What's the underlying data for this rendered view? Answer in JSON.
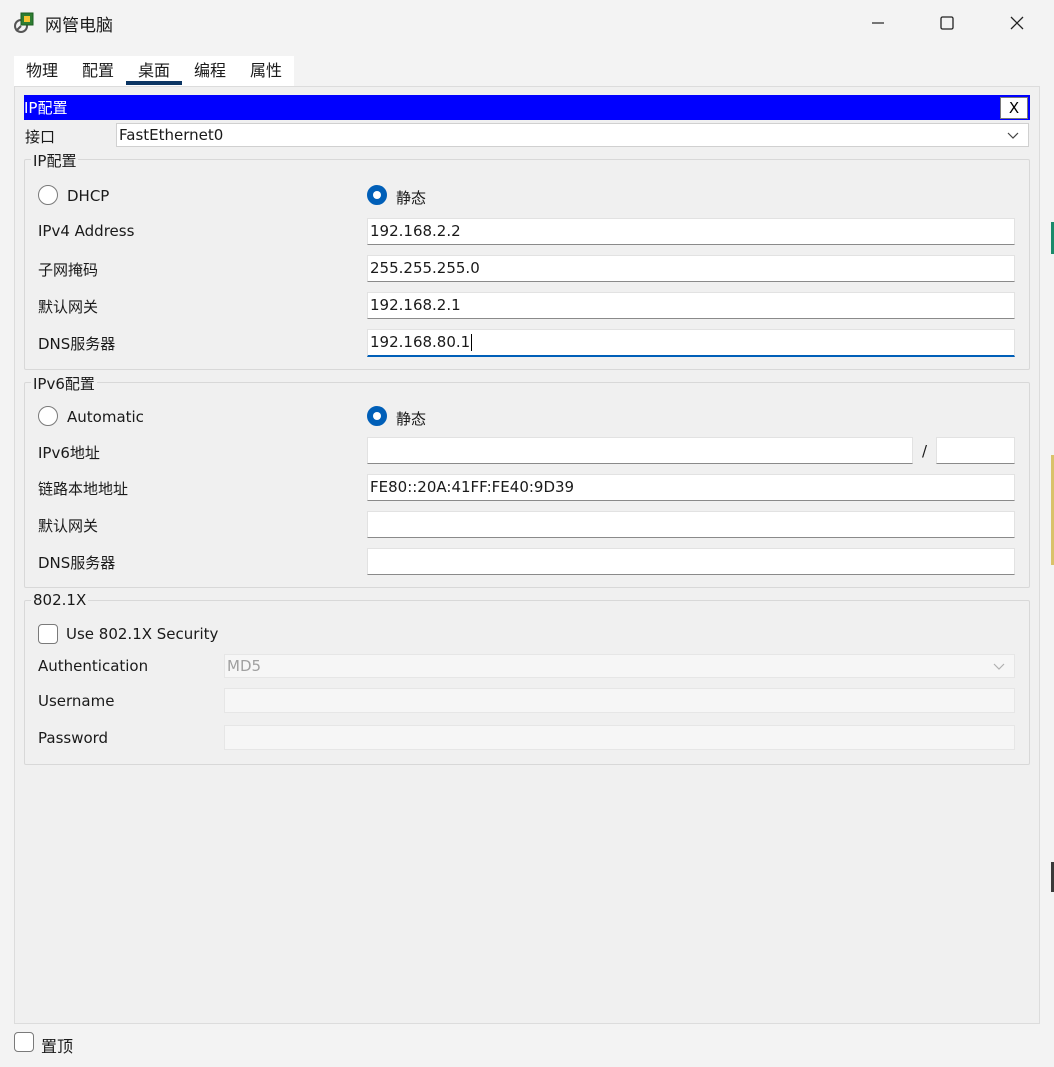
{
  "window": {
    "title": "网管电脑"
  },
  "tabs": [
    {
      "label": "物理"
    },
    {
      "label": "配置"
    },
    {
      "label": "桌面"
    },
    {
      "label": "编程"
    },
    {
      "label": "属性"
    }
  ],
  "ip_panel": {
    "header": "IP配置",
    "close_label": "X",
    "interface_label": "接口",
    "interface_value": "FastEthernet0"
  },
  "ipv4": {
    "group_title": "IP配置",
    "dhcp_label": "DHCP",
    "static_label": "静态",
    "mode_selected": "静态",
    "address_label": "IPv4 Address",
    "address_value": "192.168.2.2",
    "mask_label": "子网掩码",
    "mask_value": "255.255.255.0",
    "gateway_label": "默认网关",
    "gateway_value": "192.168.2.1",
    "dns_label": "DNS服务器",
    "dns_value": "192.168.80.1"
  },
  "ipv6": {
    "group_title": "IPv6配置",
    "auto_label": "Automatic",
    "static_label": "静态",
    "mode_selected": "静态",
    "address_label": "IPv6地址",
    "address_value": "",
    "prefix_separator": "/",
    "prefix_value": "",
    "link_local_label": "链路本地地址",
    "link_local_value": "FE80::20A:41FF:FE40:9D39",
    "gateway_label": "默认网关",
    "gateway_value": "",
    "dns_label": "DNS服务器",
    "dns_value": ""
  },
  "dot1x": {
    "group_title": "802.1X",
    "use_label": "Use 802.1X Security",
    "use_checked": false,
    "auth_label": "Authentication",
    "auth_value": "MD5",
    "username_label": "Username",
    "username_value": "",
    "password_label": "Password",
    "password_value": ""
  },
  "footer": {
    "pin_label": "置顶",
    "pin_checked": false
  },
  "colors": {
    "header_bg": "#0000ff",
    "accent": "#005fb8",
    "tab_underline": "#0b3563"
  }
}
